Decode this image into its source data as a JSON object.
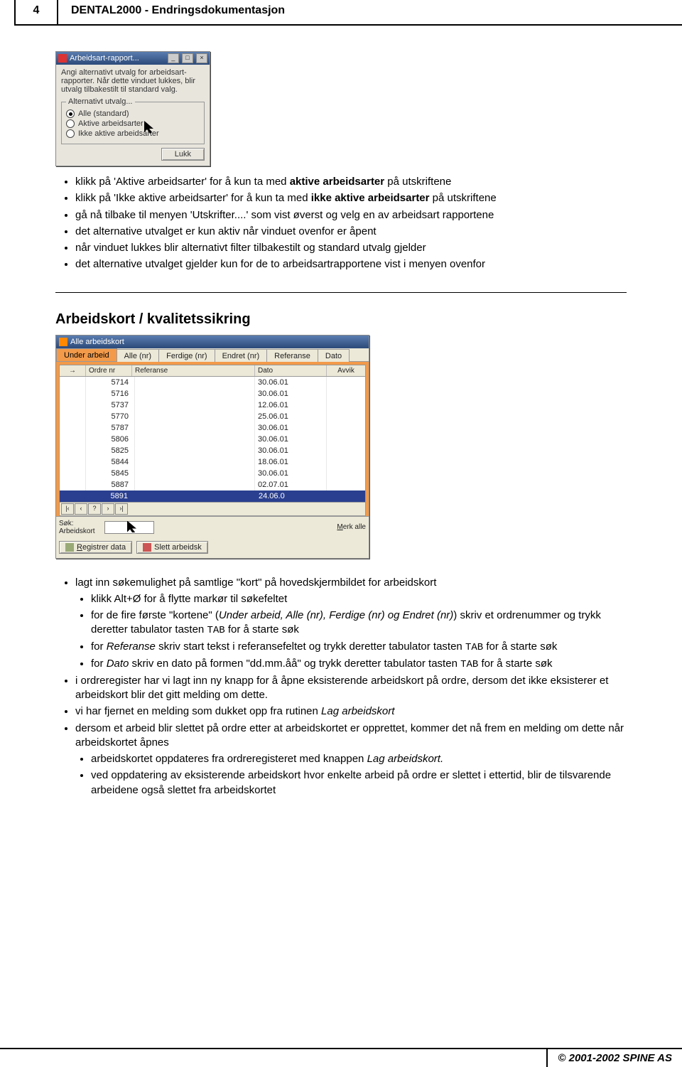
{
  "header": {
    "page_no": "4",
    "title": "DENTAL2000 - Endringsdokumentasjon"
  },
  "dialog": {
    "title": "Arbeidsart-rapport...",
    "help": "Angi alternativt utvalg for arbeidsart-rapporter. Når dette vinduet lukkes, blir utvalg tilbakestilt til standard valg.",
    "legend": "Alternativt utvalg...",
    "opt_all": "Alle (standard)",
    "opt_active": "Aktive arbeidsarter",
    "opt_inactive": "Ikke aktive arbeidsarter",
    "close": "Lukk"
  },
  "list1": {
    "i1_a": "klikk på 'Aktive arbeidsarter' for å kun ta med ",
    "i1_b": "aktive arbeidsarter",
    "i1_c": " på utskriftene",
    "i2_a": "klikk på 'Ikke aktive arbeidsarter' for å kun ta med ",
    "i2_b": "ikke aktive arbeidsarter",
    "i2_c": " på utskriftene",
    "i3": "gå nå tilbake til menyen 'Utskrifter....' som vist øverst og velg en av arbeidsart rapportene",
    "i4": "det alternative utvalget er kun aktiv når vinduet ovenfor er åpent",
    "i5": "når vinduet lukkes blir alternativt filter tilbakestilt og standard utvalg gjelder",
    "i6": "det alternative utvalget gjelder kun for de to arbeidsartrapportene vist i menyen ovenfor"
  },
  "section2_title": "Arbeidskort / kvalitetssikring",
  "kort": {
    "title": "Alle arbeidskort",
    "tabs": [
      "Under arbeid",
      "Alle (nr)",
      "Ferdige (nr)",
      "Endret (nr)",
      "Referanse",
      "Dato"
    ],
    "cols": {
      "arrow": "→",
      "ordre": "Ordre nr",
      "ref": "Referanse",
      "dato": "Dato",
      "avvik": "Avvik"
    },
    "rows": [
      {
        "ordre": "5714",
        "dato": "30.06.01"
      },
      {
        "ordre": "5716",
        "dato": "30.06.01"
      },
      {
        "ordre": "5737",
        "dato": "12.06.01"
      },
      {
        "ordre": "5770",
        "dato": "25.06.01"
      },
      {
        "ordre": "5787",
        "dato": "30.06.01"
      },
      {
        "ordre": "5806",
        "dato": "30.06.01"
      },
      {
        "ordre": "5825",
        "dato": "30.06.01"
      },
      {
        "ordre": "5844",
        "dato": "18.06.01"
      },
      {
        "ordre": "5845",
        "dato": "30.06.01"
      },
      {
        "ordre": "5887",
        "dato": "02.07.01"
      },
      {
        "ordre": "5891",
        "dato": "24.06.0",
        "sel": true
      }
    ],
    "sok_label": "Søk:\nArbeidskort",
    "merk": "Merk alle",
    "btn_reg": "Registrer data",
    "btn_del": "Slett arbeidsk"
  },
  "list2": {
    "i1": "lagt inn søkemulighet på samtlige \"kort\" på hovedskjermbildet for arbeidskort",
    "i1a": "klikk Alt+Ø for å flytte markør til søkefeltet",
    "i1b_a": "for de fire første \"kortene\" (",
    "i1b_b": "Under arbeid, Alle (nr), Ferdige (nr) og Endret (nr)",
    "i1b_c": ") skriv et ordrenummer og trykk deretter tabulator tasten ",
    "i1b_d": "TAB",
    "i1b_e": " for å starte søk",
    "i1c_a": "for ",
    "i1c_b": "Referanse",
    "i1c_c": " skriv start tekst i referansefeltet og trykk deretter tabulator tasten ",
    "i1c_d": "TAB",
    "i1c_e": " for å starte søk",
    "i1d_a": "for ",
    "i1d_b": "Dato",
    "i1d_c": " skriv en dato på formen \"dd.mm.åå\" og trykk deretter tabulator tasten ",
    "i1d_d": "TAB",
    "i1d_e": " for å starte søk",
    "i2": "i ordreregister har vi lagt inn ny knapp for å åpne eksisterende arbeidskort på ordre, dersom det ikke eksisterer et arbeidskort blir det gitt melding om dette.",
    "i3_a": "vi har fjernet en melding som dukket opp fra rutinen ",
    "i3_b": "Lag arbeidskort",
    "i4": "dersom et arbeid blir slettet på ordre etter at arbeidskortet er opprettet, kommer det nå frem en melding om dette når arbeidskortet åpnes",
    "i4a_a": "arbeidskortet oppdateres fra ordreregisteret med knappen ",
    "i4a_b": "Lag arbeidskort.",
    "i4b": "ved oppdatering av eksisterende arbeidskort hvor enkelte arbeid på ordre er slettet i ettertid, blir de tilsvarende arbeidene også slettet fra arbeidskortet"
  },
  "footer": {
    "copyright": "© 2001-2002  SPINE AS"
  }
}
